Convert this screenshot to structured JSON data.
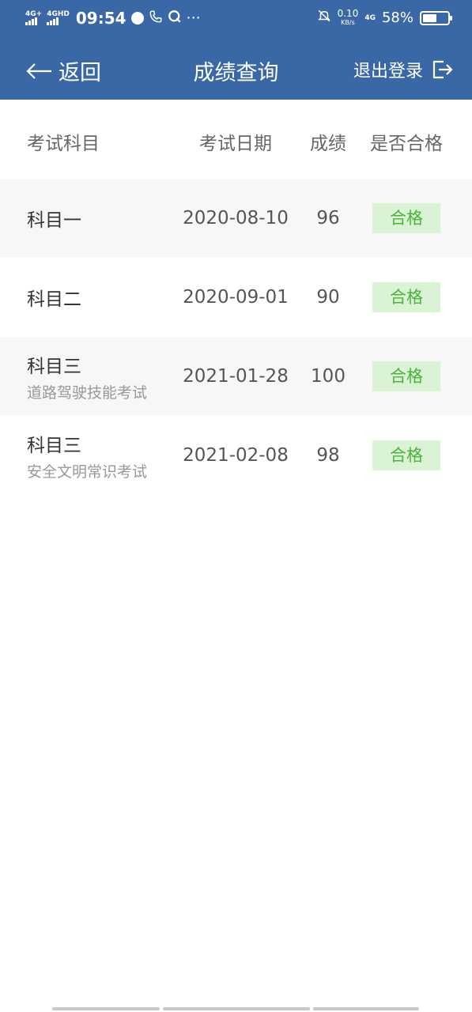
{
  "status_bar": {
    "signal_1": "4G+",
    "signal_2": "4GHD",
    "time": "09:54",
    "more": "···",
    "net_speed": "0.10",
    "net_unit": "KB/s",
    "net_type": "4G",
    "battery": "58%",
    "battery_level": 0.58
  },
  "nav": {
    "back_label": "返回",
    "title": "成绩查询",
    "logout_label": "退出登录"
  },
  "table": {
    "headers": {
      "subject": "考试科目",
      "date": "考试日期",
      "score": "成绩",
      "pass": "是否合格"
    },
    "rows": [
      {
        "subject": "科目一",
        "detail": "",
        "date": "2020-08-10",
        "score": "96",
        "pass": "合格"
      },
      {
        "subject": "科目二",
        "detail": "",
        "date": "2020-09-01",
        "score": "90",
        "pass": "合格"
      },
      {
        "subject": "科目三",
        "detail": "道路驾驶技能考试",
        "date": "2021-01-28",
        "score": "100",
        "pass": "合格"
      },
      {
        "subject": "科目三",
        "detail": "安全文明常识考试",
        "date": "2021-02-08",
        "score": "98",
        "pass": "合格"
      }
    ]
  },
  "colors": {
    "header_bg": "#3a68a6",
    "pass_bg": "#d9f3d4",
    "pass_text": "#4bb23e"
  }
}
